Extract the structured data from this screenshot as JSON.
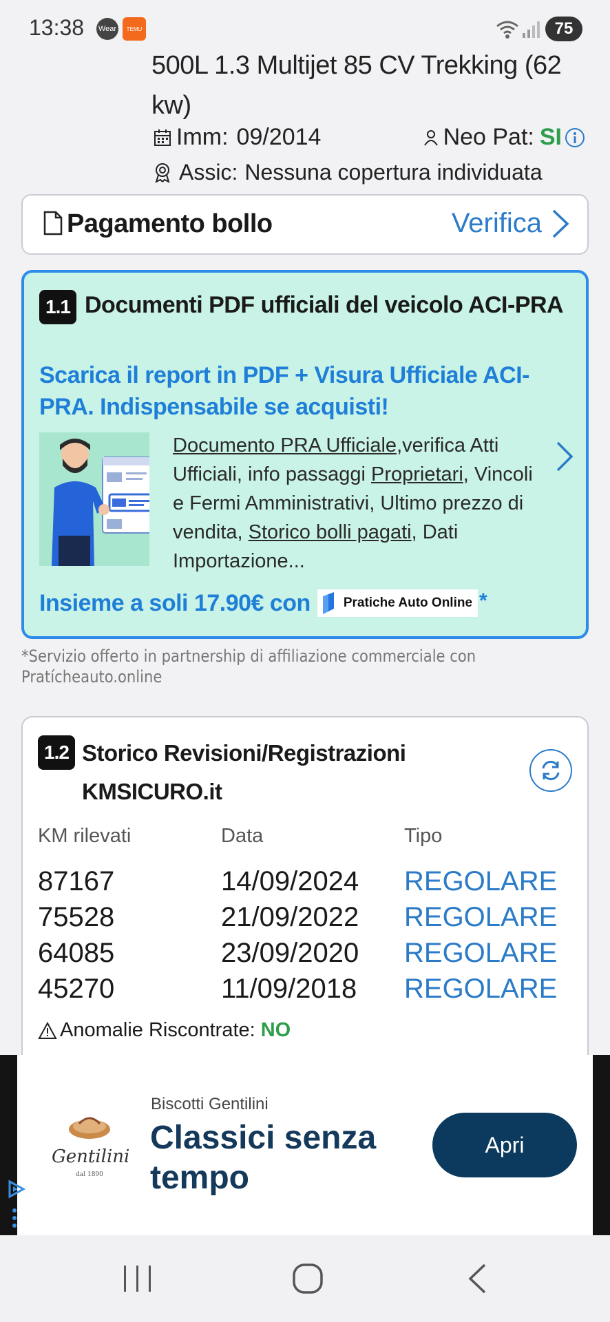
{
  "status_bar": {
    "time": "13:38",
    "wear_label": "Wear",
    "temu_label": "TEMU",
    "battery": "75"
  },
  "vehicle": {
    "model": "500L 1.3 Multijet 85 CV Trekking (62 kw)",
    "imm_label": "Imm:",
    "imm_value": "09/2014",
    "neo_label": "Neo Pat:",
    "neo_value": "SI",
    "assic_label": "Assic:",
    "assic_value": "Nessuna copertura individuata"
  },
  "bollo": {
    "label": "Pagamento bollo",
    "action": "Verifica"
  },
  "pdf": {
    "badge": "1.1",
    "title": "Documenti PDF ufficiali del veicolo ACI-PRA",
    "subtitle": "Scarica il report in PDF + Visura Ufficiale ACI-PRA. Indispensabile se acquisti!",
    "desc_link1": "Documento PRA Ufficiale",
    "desc_text1": ",verifica Atti Ufficiali, info passaggi ",
    "desc_link2": "Proprietari",
    "desc_text2": ", Vincoli e Fermi Amministrativi, Ultimo prezzo di vendita, ",
    "desc_link3": "Storico bolli pagati",
    "desc_text3": ", Dati Importazione...",
    "price_text": "Insieme a soli 17.90€ con",
    "partner_logo": "Pratiche Auto Online",
    "asterisk": "*"
  },
  "partner_note": "*Servizio offerto in partnership di affiliazione commerciale con Pratícheauto.online",
  "revisions": {
    "badge": "1.2",
    "title": "Storico Revisioni/Registrazioni KMSICURO.it",
    "headers": [
      "KM rilevati",
      "Data",
      "Tipo"
    ],
    "rows": [
      {
        "km": "87167",
        "date": "14/09/2024",
        "type": "REGOLARE"
      },
      {
        "km": "75528",
        "date": "21/09/2022",
        "type": "REGOLARE"
      },
      {
        "km": "64085",
        "date": "23/09/2020",
        "type": "REGOLARE"
      },
      {
        "km": "45270",
        "date": "11/09/2018",
        "type": "REGOLARE"
      }
    ],
    "anomalies_label": "Anomalie Riscontrate:",
    "anomalies_value": "NO"
  },
  "ad": {
    "logo_text": "Gentilini",
    "logo_sub": "dal 1890",
    "advertiser": "Biscotti Gentilini",
    "headline": "Classici senza tempo",
    "button": "Apri"
  },
  "colors": {
    "accent_blue": "#2b7bc8",
    "success_green": "#2e9e4a",
    "pdf_card_bg": "#c9f3e6",
    "ad_button": "#0b3a5e"
  }
}
